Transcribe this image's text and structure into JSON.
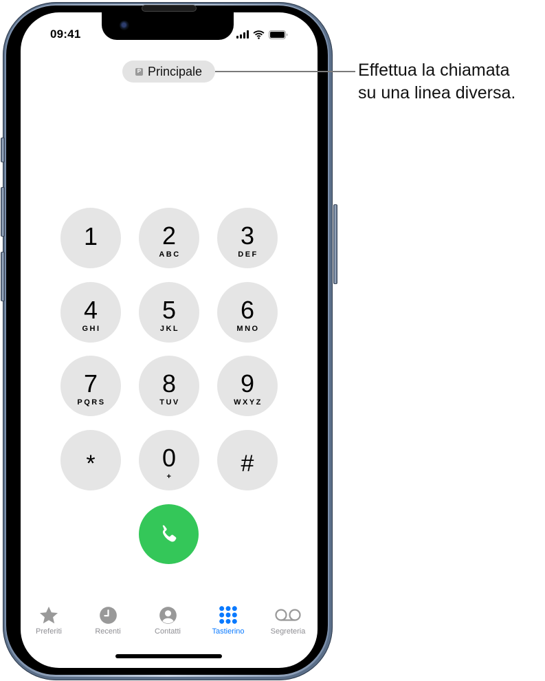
{
  "status_bar": {
    "time": "09:41",
    "signal_icon": "cellular-signal-icon",
    "wifi_icon": "wifi-icon",
    "battery_icon": "battery-icon"
  },
  "line_selector": {
    "badge": "P",
    "label": "Principale"
  },
  "callout": {
    "line1": "Effettua la chiamata",
    "line2": "su una linea diversa."
  },
  "keypad": {
    "keys": [
      {
        "digit": "1",
        "letters": ""
      },
      {
        "digit": "2",
        "letters": "ABC"
      },
      {
        "digit": "3",
        "letters": "DEF"
      },
      {
        "digit": "4",
        "letters": "GHI"
      },
      {
        "digit": "5",
        "letters": "JKL"
      },
      {
        "digit": "6",
        "letters": "MNO"
      },
      {
        "digit": "7",
        "letters": "PQRS"
      },
      {
        "digit": "8",
        "letters": "TUV"
      },
      {
        "digit": "9",
        "letters": "WXYZ"
      },
      {
        "digit": "*",
        "letters": ""
      },
      {
        "digit": "0",
        "letters": "+"
      },
      {
        "digit": "#",
        "letters": ""
      }
    ],
    "call_icon": "phone-icon",
    "call_color": "#34c759"
  },
  "tab_bar": {
    "active_color": "#0a7aff",
    "inactive_color": "#8e8e93",
    "tabs": [
      {
        "label": "Preferiti",
        "icon": "star-icon",
        "active": false
      },
      {
        "label": "Recenti",
        "icon": "clock-icon",
        "active": false
      },
      {
        "label": "Contatti",
        "icon": "person-circle-icon",
        "active": false
      },
      {
        "label": "Tastierino",
        "icon": "keypad-icon",
        "active": true
      },
      {
        "label": "Segreteria",
        "icon": "voicemail-icon",
        "active": false
      }
    ]
  }
}
